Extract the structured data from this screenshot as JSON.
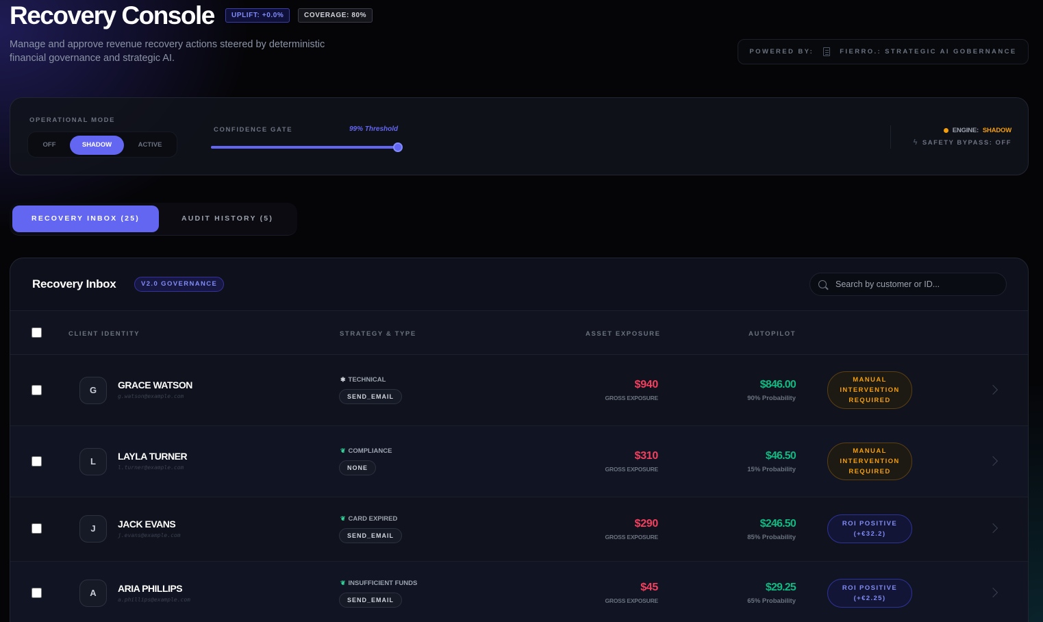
{
  "header": {
    "title": "Recovery Console",
    "uplift": "UPLIFT: +0.0%",
    "coverage": "COVERAGE: 80%",
    "subtitle": "Manage and approve revenue recovery actions steered by deterministic financial governance and strategic AI.",
    "powered_label": "POWERED BY:",
    "powered_value": "FIERRO.: STRATEGIC AI GOBERNANCE"
  },
  "controls": {
    "operational_mode_label": "OPERATIONAL MODE",
    "modes": [
      "OFF",
      "SHADOW",
      "ACTIVE"
    ],
    "selected_mode": "SHADOW",
    "confidence_label": "CONFIDENCE GATE",
    "threshold": "99% Threshold",
    "threshold_value": 0.99,
    "engine_label": "ENGINE:",
    "engine_value": "SHADOW",
    "safety_bypass": "SAFETY BYPASS: OFF"
  },
  "tabs": [
    {
      "label": "RECOVERY INBOX (25)",
      "active": true
    },
    {
      "label": "AUDIT HISTORY (5)",
      "active": false
    }
  ],
  "inbox": {
    "title": "Recovery Inbox",
    "badge": "V2.0 GOVERNANCE",
    "search_placeholder": "Search by customer or ID...",
    "columns": [
      "CLIENT IDENTITY",
      "STRATEGY & TYPE",
      "ASSET EXPOSURE",
      "AUTOPILOT"
    ],
    "rows": [
      {
        "initial": "G",
        "name": "GRACE WATSON",
        "email": "g.watson@example.com",
        "icon": "gear-icon",
        "type": "TECHNICAL",
        "action": "SEND_EMAIL",
        "exposure": "$940",
        "exposure_label": "GROSS EXPOSURE",
        "autopilot": "$846.00",
        "probability": "90% Probability",
        "status_kind": "manual",
        "status": "MANUAL INTERVENTION REQUIRED"
      },
      {
        "initial": "L",
        "name": "LAYLA TURNER",
        "email": "l.turner@example.com",
        "icon": "leaf-icon",
        "type": "COMPLIANCE",
        "action": "NONE",
        "exposure": "$310",
        "exposure_label": "GROSS EXPOSURE",
        "autopilot": "$46.50",
        "probability": "15% Probability",
        "status_kind": "manual",
        "status": "MANUAL INTERVENTION REQUIRED"
      },
      {
        "initial": "J",
        "name": "JACK EVANS",
        "email": "j.evans@example.com",
        "icon": "leaf-icon",
        "type": "CARD EXPIRED",
        "action": "SEND_EMAIL",
        "exposure": "$290",
        "exposure_label": "GROSS EXPOSURE",
        "autopilot": "$246.50",
        "probability": "85% Probability",
        "status_kind": "roi",
        "status": "ROI POSITIVE",
        "status_sub": "(+€32.2)"
      },
      {
        "initial": "A",
        "name": "ARIA PHILLIPS",
        "email": "a.phillips@example.com",
        "icon": "leaf-icon",
        "type": "INSUFFICIENT FUNDS",
        "action": "SEND_EMAIL",
        "exposure": "$45",
        "exposure_label": "GROSS EXPOSURE",
        "autopilot": "$29.25",
        "probability": "65% Probability",
        "status_kind": "roi",
        "status": "ROI POSITIVE",
        "status_sub": "(+€2.25)"
      }
    ]
  }
}
